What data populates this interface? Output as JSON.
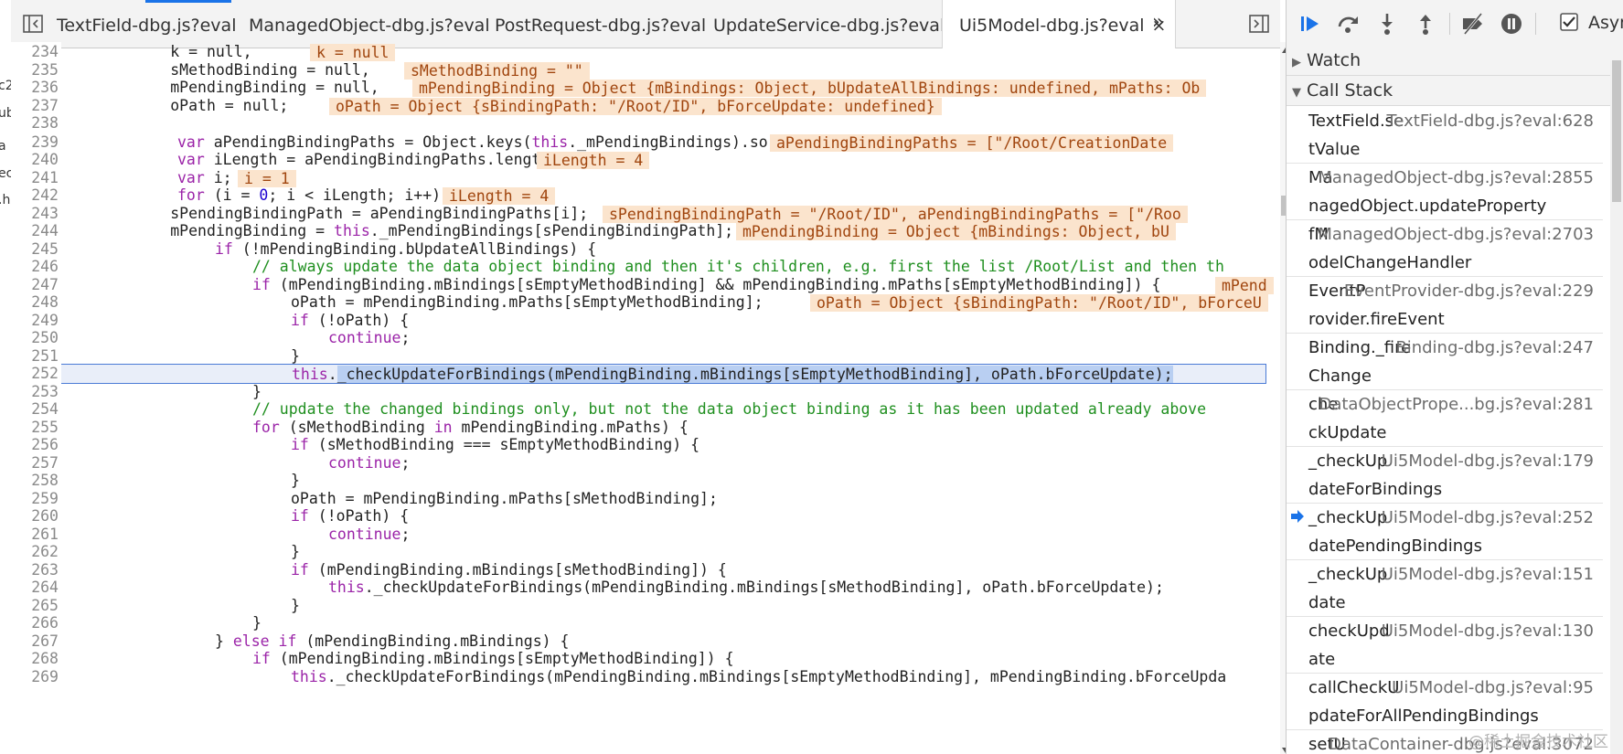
{
  "left_strip": [
    "c2",
    "ub",
    "a",
    "ec",
    ".h"
  ],
  "tabs": [
    {
      "label": "TextField-dbg.js?eval"
    },
    {
      "label": "ManagedObject-dbg.js?eval"
    },
    {
      "label": "PostRequest-dbg.js?eval"
    },
    {
      "label": "UpdateService-dbg.js?eval"
    },
    {
      "label": "Ui5Model-dbg.js?eval",
      "active": true,
      "close": "×"
    }
  ],
  "tab_overflow": "»",
  "editor": {
    "line_numbers": [
      "234",
      "235",
      "236",
      "237",
      "238",
      "239",
      "240",
      "241",
      "242",
      "243",
      "244",
      "245",
      "246",
      "247",
      "248",
      "249",
      "250",
      "251",
      "252",
      "253",
      "254",
      "255",
      "256",
      "257",
      "258",
      "259",
      "260",
      "261",
      "262",
      "263",
      "264",
      "265",
      "266",
      "267",
      "268",
      "269"
    ],
    "l234": {
      "code": "            k = null,",
      "inline": "k = null"
    },
    "l235": {
      "code": "            sMethodBinding = null,",
      "inline": "sMethodBinding = \"\""
    },
    "l236": {
      "code": "            mPendingBinding = null,",
      "inline": "mPendingBinding = Object {mBindings: Object, bUpdateAllBindings: undefined, mPaths: Ob"
    },
    "l237": {
      "code": "            oPath = null;",
      "inline": "oPath = Object {sBindingPath: \"/Root/ID\", bForceUpdate: undefined}"
    },
    "l239": {
      "kw": "var",
      "code": " aPendingBindingPaths = Object.keys(",
      "kw2": "this",
      "code2": "._mPendingBindings).sort();",
      "inline": "aPendingBindingPaths = [\"/Root/CreationDate"
    },
    "l240": {
      "kw": "var",
      "code": " iLength = aPendingBindingPaths.length;",
      "inline": "iLength = 4"
    },
    "l241": {
      "kw": "var",
      "code": " i;",
      "inline": "i = 1"
    },
    "l242": {
      "kw": "for",
      "code": " (i = ",
      "num": "0",
      "code2": "; i < iLength; i++) {",
      "inline": "iLength = 4"
    },
    "l243": {
      "code": "            sPendingBindingPath = aPendingBindingPaths[i];",
      "inline": "sPendingBindingPath = \"/Root/ID\", aPendingBindingPaths = [\"/Roo"
    },
    "l244": {
      "code": "            mPendingBinding = ",
      "kw": "this",
      "code2": "._mPendingBindings[sPendingBindingPath];",
      "inline": "mPendingBinding = Object {mBindings: Object, bU"
    },
    "l245": {
      "kw": "if",
      "code": " (!mPendingBinding.bUpdateAllBindings) {"
    },
    "l246": {
      "comment": "// always update the data object binding and then it's children, e.g. first the list /Root/List and then th"
    },
    "l247": {
      "kw": "if",
      "code": " (mPendingBinding.mBindings[sEmptyMethodBinding] && mPendingBinding.mPaths[sEmptyMethodBinding]) {",
      "inline": "mPend"
    },
    "l248": {
      "code": "oPath = mPendingBinding.mPaths[sEmptyMethodBinding];",
      "inline": "oPath = Object {sBindingPath: \"/Root/ID\", bForceU"
    },
    "l249": {
      "kw": "if",
      "code": " (!oPath) {"
    },
    "l250": {
      "kw": "continue",
      "code": ";"
    },
    "l251": {
      "code": "}"
    },
    "l252": {
      "kw": "this",
      "code": ".",
      "selected": "_checkUpdateForBindings(mPendingBinding.mBindings[sEmptyMethodBinding], oPath.bForceUpdate);"
    },
    "l253": {
      "code": "}"
    },
    "l254": {
      "comment": "// update the changed bindings only, but not the data object binding as it has been updated already above"
    },
    "l255": {
      "kw": "for",
      "code": " (sMethodBinding ",
      "kw2": "in",
      "code2": " mPendingBinding.mPaths) {"
    },
    "l256": {
      "kw": "if",
      "code": " (sMethodBinding === sEmptyMethodBinding) {"
    },
    "l257": {
      "kw": "continue",
      "code": ";"
    },
    "l258": {
      "code": "}"
    },
    "l259": {
      "code": "oPath = mPendingBinding.mPaths[sMethodBinding];"
    },
    "l260": {
      "kw": "if",
      "code": " (!oPath) {"
    },
    "l261": {
      "kw": "continue",
      "code": ";"
    },
    "l262": {
      "code": "}"
    },
    "l263": {
      "kw": "if",
      "code": " (mPendingBinding.mBindings[sMethodBinding]) {"
    },
    "l264": {
      "kw": "this",
      "code": "._checkUpdateForBindings(mPendingBinding.mBindings[sMethodBinding], oPath.bForceUpdate);"
    },
    "l265": {
      "code": "}"
    },
    "l266": {
      "code": "}"
    },
    "l267": {
      "code": "} ",
      "kw": "else if",
      "code2": " (mPendingBinding.mBindings) {"
    },
    "l268": {
      "kw": "if",
      "code": " (mPendingBinding.mBindings[sEmptyMethodBinding]) {"
    },
    "l269": {
      "kw": "this",
      "code": "._checkUpdateForBindings(mPendingBinding.mBindings[sEmptyMethodBinding], mPendingBinding.bForceUpda"
    }
  },
  "debugger": {
    "async_label": "Asyn",
    "watch_label": "Watch",
    "callstack_label": "Call Stack",
    "frames": [
      {
        "fn": "TextField.se",
        "loc": "TextField-dbg.js?eval:628",
        "fn2": "tValue"
      },
      {
        "fn": "Ma",
        "loc": "ManagedObject-dbg.js?eval:2855",
        "fn2": "nagedObject.updateProperty"
      },
      {
        "fn": "fM",
        "loc": "ManagedObject-dbg.js?eval:2703",
        "fn2": "odelChangeHandler"
      },
      {
        "fn": "EventP",
        "loc": "EventProvider-dbg.js?eval:229",
        "fn2": "rovider.fireEvent"
      },
      {
        "fn": "Binding._fire",
        "loc": "Binding-dbg.js?eval:247",
        "fn2": "Change"
      },
      {
        "fn": "che",
        "loc": "DataObjectPrope...bg.js?eval:281",
        "fn2": "ckUpdate"
      },
      {
        "fn": "_checkUp",
        "loc": "Ui5Model-dbg.js?eval:179",
        "fn2": "dateForBindings"
      },
      {
        "fn": "_checkUp",
        "loc": "Ui5Model-dbg.js?eval:252",
        "fn2": "datePendingBindings",
        "current": true
      },
      {
        "fn": "_checkUp",
        "loc": "Ui5Model-dbg.js?eval:151",
        "fn2": "date"
      },
      {
        "fn": "checkUpd",
        "loc": "Ui5Model-dbg.js?eval:130",
        "fn2": "ate"
      },
      {
        "fn": "callCheckU",
        "loc": "Ui5Model-dbg.js?eval:95",
        "fn2": "pdateForAllPendingBindings"
      },
      {
        "fn": "setU",
        "loc": "DataContainer-dbg.js?eval:3072",
        "fn2": ""
      }
    ]
  },
  "watermark": "@稀土掘金技术社区",
  "colors": {
    "inline_bg": "#fbe4cd",
    "inline_fg": "#a0450e",
    "keyword": "#9b24a8",
    "comment": "#1f8f1f",
    "number": "#1c00cf",
    "accent": "#1a73e8",
    "selection": "#b9cff2"
  }
}
